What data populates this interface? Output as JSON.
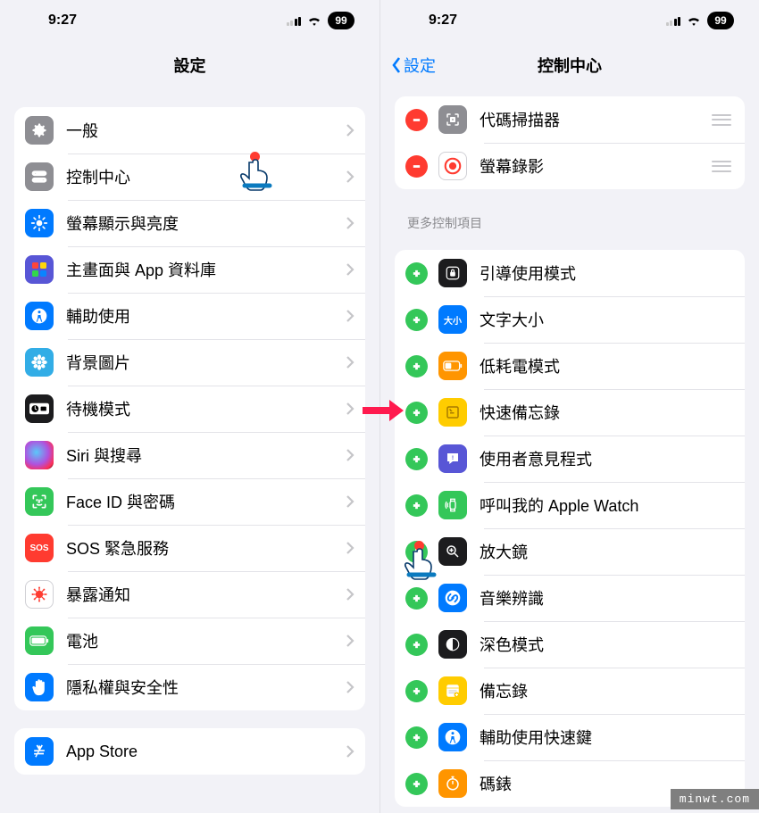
{
  "status": {
    "time": "9:27",
    "battery": "99"
  },
  "left": {
    "title": "設定",
    "items": [
      {
        "id": "general",
        "label": "一般"
      },
      {
        "id": "control-center",
        "label": "控制中心"
      },
      {
        "id": "display",
        "label": "螢幕顯示與亮度"
      },
      {
        "id": "home",
        "label": "主畫面與 App 資料庫"
      },
      {
        "id": "accessibility",
        "label": "輔助使用"
      },
      {
        "id": "wallpaper",
        "label": "背景圖片"
      },
      {
        "id": "standby",
        "label": "待機模式"
      },
      {
        "id": "siri",
        "label": "Siri 與搜尋"
      },
      {
        "id": "faceid",
        "label": "Face ID 與密碼"
      },
      {
        "id": "sos",
        "label": "SOS 緊急服務"
      },
      {
        "id": "exposure",
        "label": "暴露通知"
      },
      {
        "id": "battery",
        "label": "電池"
      },
      {
        "id": "privacy",
        "label": "隱私權與安全性"
      }
    ],
    "group2": [
      {
        "id": "appstore",
        "label": "App Store"
      }
    ]
  },
  "right": {
    "back_label": "設定",
    "title": "控制中心",
    "included": [
      {
        "id": "qr",
        "label": "代碼掃描器"
      },
      {
        "id": "screenrec",
        "label": "螢幕錄影"
      }
    ],
    "more_header": "更多控制項目",
    "more": [
      {
        "id": "guided",
        "label": "引導使用模式"
      },
      {
        "id": "textsize",
        "label": "文字大小",
        "txt": "大小"
      },
      {
        "id": "lowpower",
        "label": "低耗電模式"
      },
      {
        "id": "quicknote",
        "label": "快速備忘錄"
      },
      {
        "id": "feedback",
        "label": "使用者意見程式"
      },
      {
        "id": "pingwatch",
        "label": "呼叫我的 Apple Watch"
      },
      {
        "id": "magnifier",
        "label": "放大鏡"
      },
      {
        "id": "shazam",
        "label": "音樂辨識"
      },
      {
        "id": "darkmode",
        "label": "深色模式"
      },
      {
        "id": "notes",
        "label": "備忘錄"
      },
      {
        "id": "shortcuts",
        "label": "輔助使用快速鍵"
      },
      {
        "id": "stopwatch",
        "label": "碼錶"
      }
    ]
  },
  "watermark": "minwt.com"
}
